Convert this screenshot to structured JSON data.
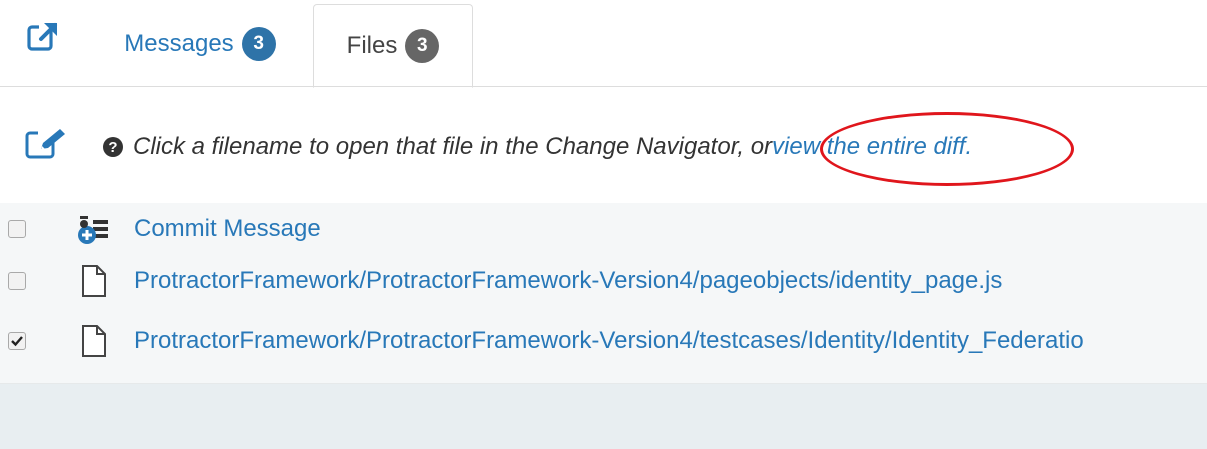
{
  "tabs": [
    {
      "label": "Messages",
      "count": "3",
      "active": false
    },
    {
      "label": "Files",
      "count": "3",
      "active": true
    }
  ],
  "help": {
    "text": "Click a filename to open that file in the Change Navigator, or ",
    "link": "view the entire diff",
    "suffix": "."
  },
  "files": [
    {
      "label": "Commit Message",
      "checked": false,
      "icon": "commit-message-icon"
    },
    {
      "label": "ProtractorFramework/ProtractorFramework-Version4/pageobjects/identity_page.js",
      "checked": false,
      "icon": "file-icon"
    },
    {
      "label": "ProtractorFramework/ProtractorFramework-Version4/testcases/Identity/Identity_Federatio",
      "checked": true,
      "icon": "file-icon"
    }
  ],
  "colors": {
    "link": "#2878b8",
    "badge_messages": "#2e73a8",
    "badge_files": "#666666",
    "annotation": "#e0161c",
    "list_background": "#f5f7f8"
  },
  "icons": [
    "external-link-icon",
    "edit-icon",
    "question-circle-icon",
    "commit-message-icon",
    "file-icon",
    "checkmark-icon"
  ]
}
